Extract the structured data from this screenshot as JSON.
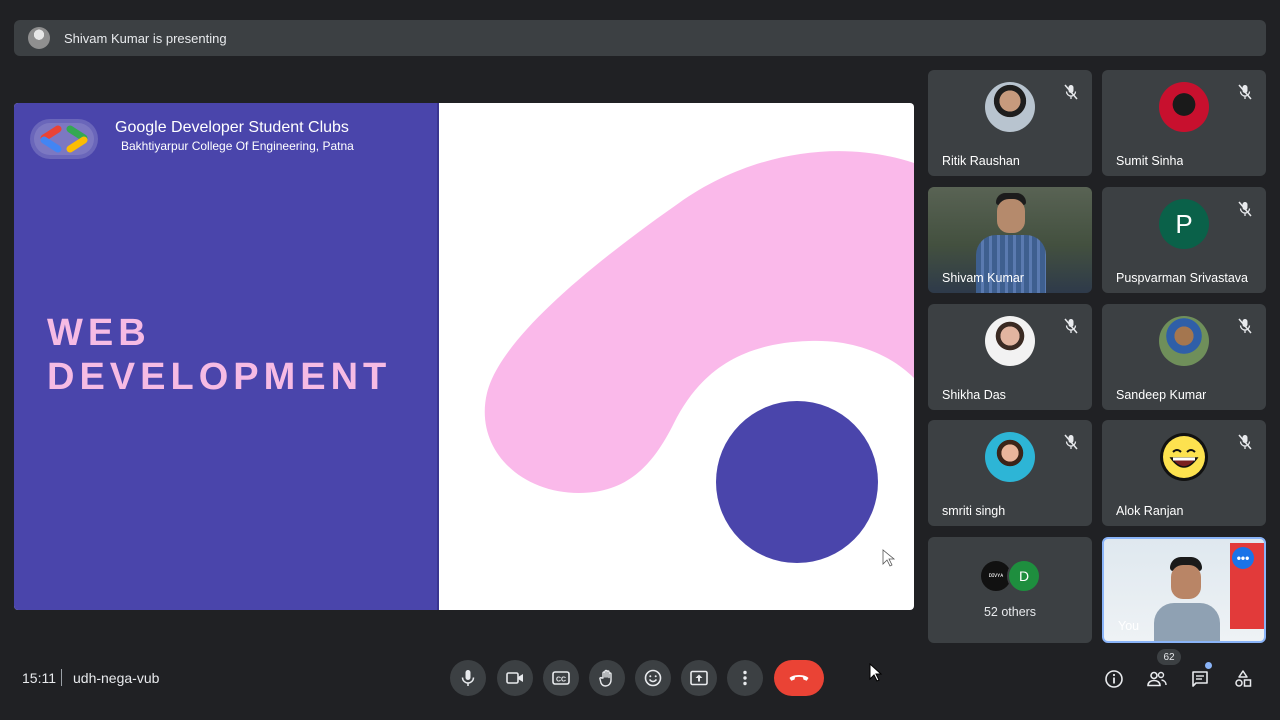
{
  "presentation": {
    "banner_text": "Shivam Kumar is presenting"
  },
  "slide": {
    "org_title": "Google Developer Student Clubs",
    "org_subtitle": "Bakhtiyarpur College Of Engineering, Patna",
    "heading_line1": "WEB",
    "heading_line2": "DEVELOPMENT",
    "colors": {
      "left_panel": "#4a45ab",
      "heading": "#f6bbe4",
      "blob": "#fab9ea",
      "circle": "#4a45ab"
    }
  },
  "participants": [
    {
      "name": "Ritik Raushan",
      "muted": true,
      "display": "photo"
    },
    {
      "name": "Sumit Sinha",
      "muted": true,
      "display": "photo"
    },
    {
      "name": "Shivam Kumar",
      "muted": false,
      "display": "video"
    },
    {
      "name": "Puspvarman Srivastava",
      "muted": true,
      "display": "letter",
      "initial": "P"
    },
    {
      "name": "Shikha Das",
      "muted": true,
      "display": "photo"
    },
    {
      "name": "Sandeep Kumar",
      "muted": true,
      "display": "photo"
    },
    {
      "name": "smriti singh",
      "muted": true,
      "display": "photo"
    },
    {
      "name": "Alok Ranjan",
      "muted": true,
      "display": "emoji"
    }
  ],
  "others_tile": {
    "label": "52 others",
    "avatar_letter": "D",
    "avatar_text": "ᴅɪᴠʏᴀ"
  },
  "self_tile": {
    "label": "You"
  },
  "meeting": {
    "time": "15:11",
    "code": "udh-nega-vub"
  },
  "controls": [
    {
      "name": "microphone",
      "icon": "mic-icon"
    },
    {
      "name": "camera",
      "icon": "videocam-icon"
    },
    {
      "name": "captions",
      "icon": "closed-caption-icon"
    },
    {
      "name": "raise-hand",
      "icon": "hand-icon"
    },
    {
      "name": "reactions",
      "icon": "emoji-icon"
    },
    {
      "name": "present",
      "icon": "present-screen-icon"
    },
    {
      "name": "more-options",
      "icon": "more-vert-icon"
    },
    {
      "name": "leave-call",
      "icon": "call-end-icon"
    }
  ],
  "side_controls": {
    "people_count": "62"
  }
}
